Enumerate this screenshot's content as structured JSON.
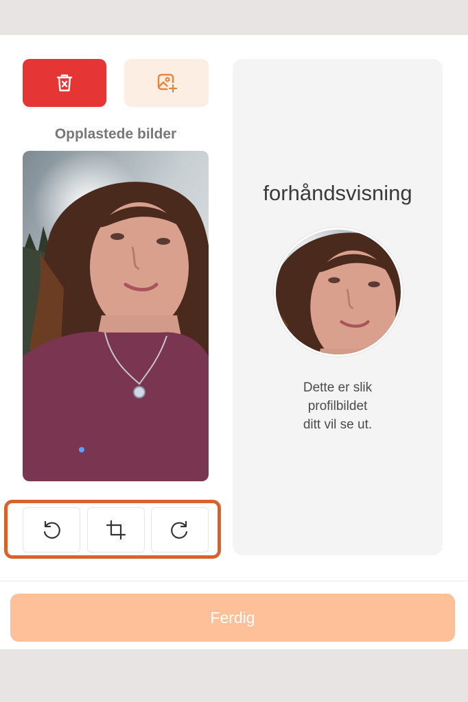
{
  "toolbar": {
    "delete_icon": "trash-x-icon",
    "add_icon": "add-image-icon"
  },
  "uploaded": {
    "label": "Opplastede bilder"
  },
  "edit_tools": {
    "rotate_left_icon": "rotate-left-icon",
    "crop_icon": "crop-icon",
    "rotate_right_icon": "rotate-right-icon"
  },
  "preview": {
    "title": "forhåndsvisning",
    "note_line1": "Dette er slik",
    "note_line2": "profilbildet",
    "note_line3": "ditt vil se ut."
  },
  "footer": {
    "done_label": "Ferdig"
  },
  "colors": {
    "delete": "#e53535",
    "add_bg": "#fdeee4",
    "accent": "#e8833a",
    "highlight": "#d9622a",
    "done_bg": "#fdc098"
  }
}
